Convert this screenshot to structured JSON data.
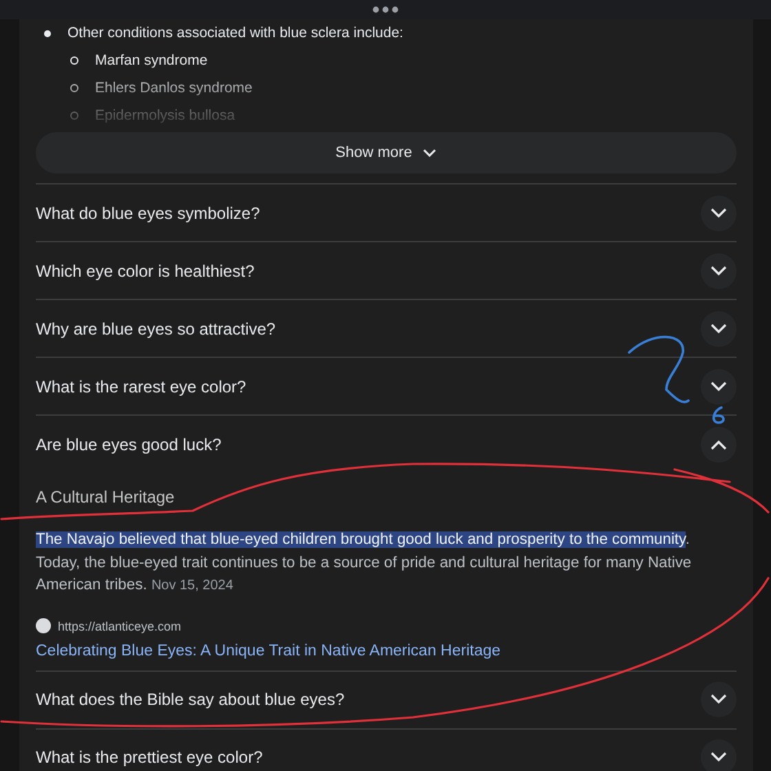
{
  "preview": {
    "collapsed": true,
    "items": [
      {
        "text": "Other conditions associated with blue sclera include:",
        "children": [
          {
            "text": "Marfan syndrome"
          },
          {
            "text": "Ehlers Danlos syndrome"
          },
          {
            "text": "Epidermolysis bullosa"
          }
        ]
      }
    ]
  },
  "show_more": {
    "label": "Show more"
  },
  "questions": [
    {
      "text": "What do blue eyes symbolize?",
      "expanded": false
    },
    {
      "text": "Which eye color is healthiest?",
      "expanded": false
    },
    {
      "text": "Why are blue eyes so attractive?",
      "expanded": false
    },
    {
      "text": "What is the rarest eye color?",
      "expanded": false
    },
    {
      "text": "Are blue eyes good luck?",
      "expanded": true,
      "answer": {
        "heading": "A Cultural Heritage",
        "parts": [
          {
            "text": "The Navajo believed that blue-eyed children brought good luck and prosperity to the community",
            "highlighted": true
          },
          {
            "text": ". Today, the blue-eyed trait continues to be a source of pride and cultural heritage for many Native American tribes.",
            "highlighted": false
          }
        ],
        "date": "Nov 15, 2024",
        "source_url": "https://atlanticeye.com",
        "source_title": "Celebrating Blue Eyes: A Unique Trait in Native American Heritage"
      }
    },
    {
      "text": "What does the Bible say about blue eyes?",
      "expanded": false
    },
    {
      "text": "What is the prettiest eye color?",
      "expanded": false
    }
  ]
}
